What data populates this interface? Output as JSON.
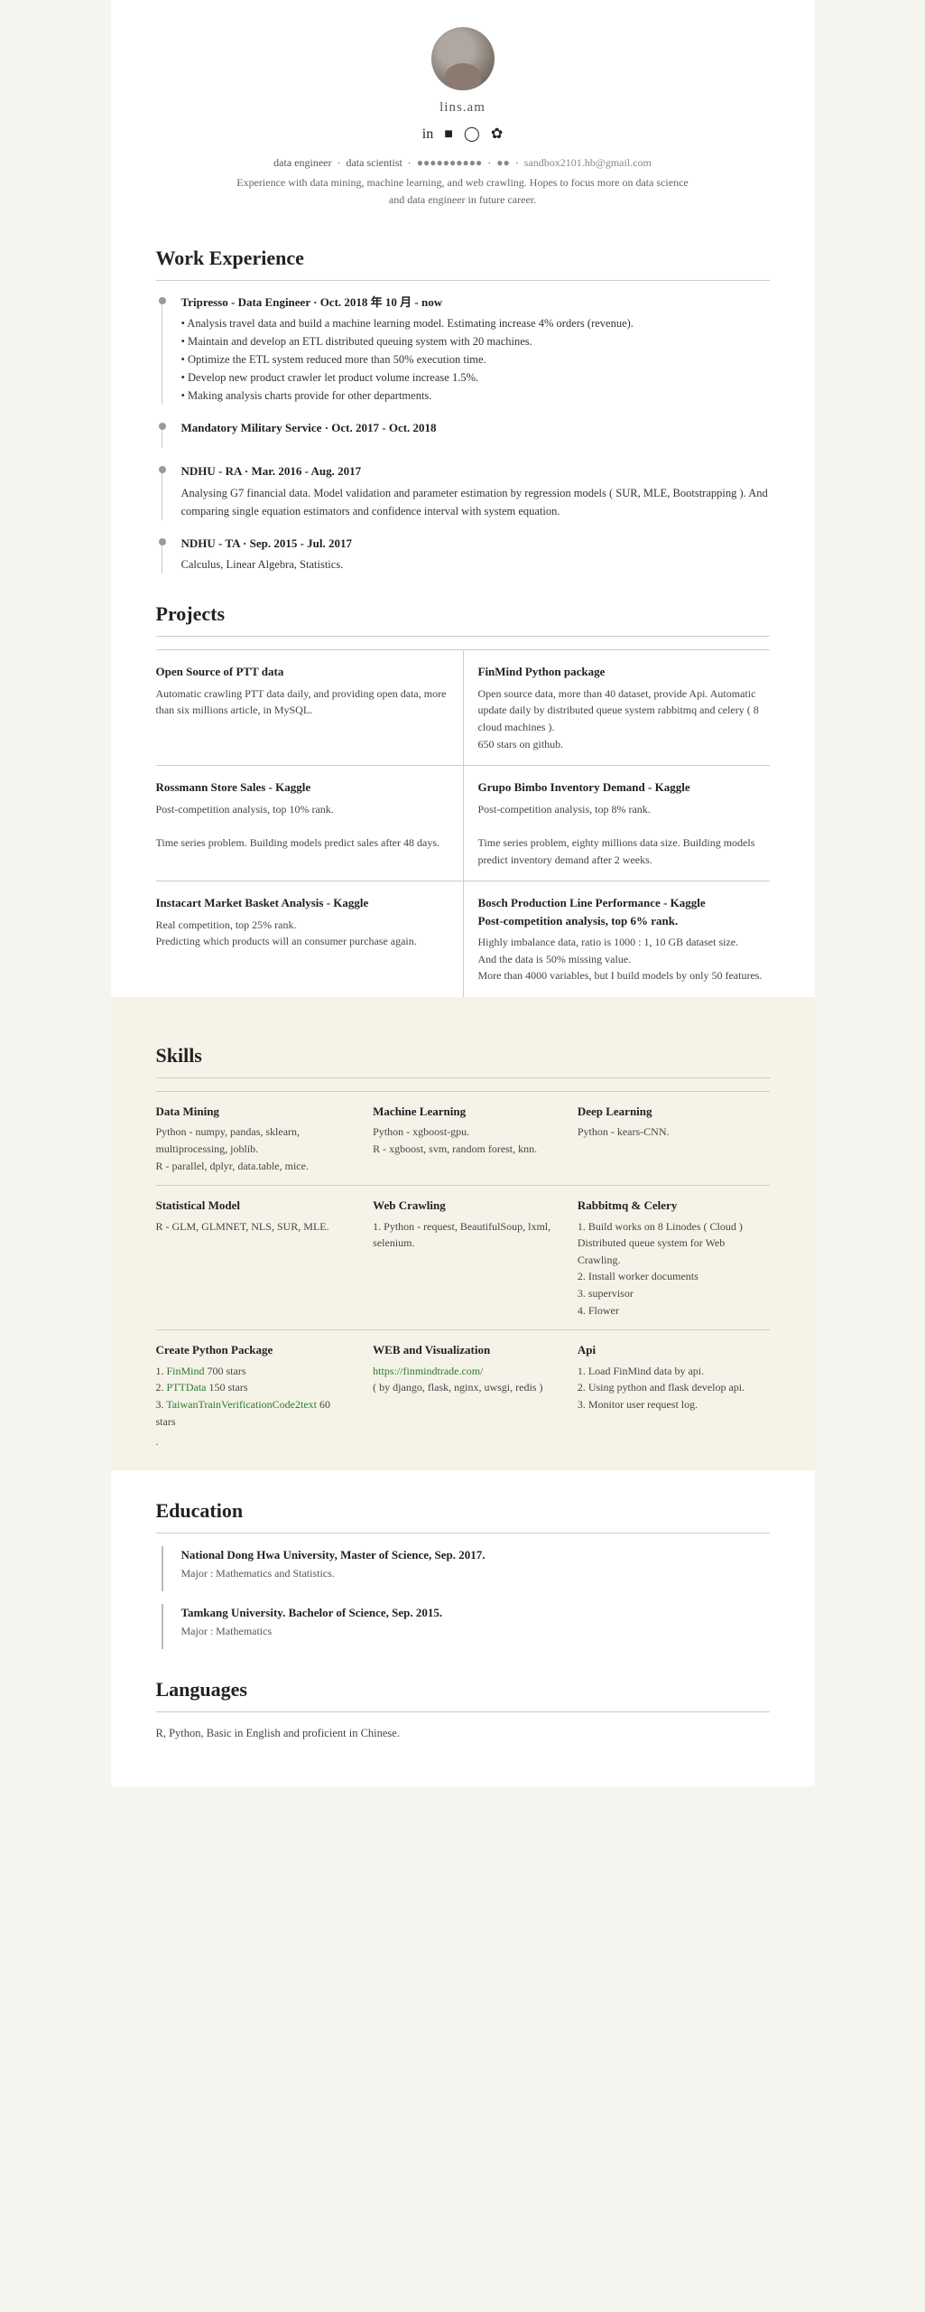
{
  "header": {
    "name": "lins.am",
    "tagline": "data engineer · data scientist · [phone] · [location] · sandbox2101.hb@gmail.com",
    "bio": "Experience with data mining, machine learning, and web crawling. Hopes to focus more on data science and data engineer in future career.",
    "social": [
      "in",
      "f",
      "⌥",
      "✿"
    ]
  },
  "sections": {
    "work_experience": "Work Experience",
    "projects": "Projects",
    "skills": "Skills",
    "education": "Education",
    "languages": "Languages"
  },
  "work": [
    {
      "title": "Tripresso - Data Engineer · Oct. 2018 年 10 月 - now",
      "desc": "• Analysis travel data and build a machine learning model. Estimating increase 4% orders (revenue).\n• Maintain and develop an ETL distributed queuing system with 20 machines.\n• Optimize the ETL system reduced more than 50% execution time.\n• Develop new product crawler let product volume increase 1.5%.\n• Making analysis charts provide for other departments."
    },
    {
      "title": "Mandatory Military Service · Oct. 2017 - Oct. 2018",
      "desc": ""
    },
    {
      "title": "NDHU - RA · Mar. 2016 - Aug. 2017",
      "desc": "Analysing G7 financial data. Model validation and parameter estimation by regression models ( SUR, MLE, Bootstrapping ). And comparing single equation estimators and confidence interval with system equation."
    },
    {
      "title": "NDHU - TA · Sep. 2015 - Jul. 2017",
      "desc": "Calculus, Linear Algebra, Statistics."
    }
  ],
  "projects": [
    {
      "title": "Open Source of PTT data",
      "desc": "Automatic crawling PTT data daily, and providing open data, more than six millions article, in MySQL."
    },
    {
      "title": "FinMind Python package",
      "desc": "Open source data, more than 40 dataset, provide Api. Automatic update daily by distributed queue system rabbitmq and celery ( 8 cloud machines ). 650 stars on github."
    },
    {
      "title": "Rossmann Store Sales - Kaggle",
      "desc": "Post-competition analysis, top 10% rank.\n\nTime series problem. Building models predict sales after 48 days."
    },
    {
      "title": "Grupo Bimbo Inventory Demand - Kaggle",
      "desc": "Post-competition analysis, top 8% rank.\n\nTime series problem, eighty millions data size. Building models predict inventory demand after 2 weeks."
    },
    {
      "title": "Instacart Market Basket Analysis - Kaggle",
      "desc": "Real competition, top 25% rank.\nPredicting which products will an consumer purchase again."
    },
    {
      "title": "Bosch Production Line Performance - Kaggle Post-competition analysis, top 6% rank.",
      "desc": "Highly imbalance data, ratio is 1000 : 1, 10 GB dataset size.\nAnd the data is 50% missing value.\nMore than 4000 variables, but I build models by only 50 features."
    }
  ],
  "skills": [
    {
      "title": "Data Mining",
      "desc": "Python - numpy, pandas, sklearn, multiprocessing, joblib.\nR - parallel, dplyr, data.table, mice."
    },
    {
      "title": "Machine Learning",
      "desc": "Python - xgboost-gpu.\nR - xgboost, svm, random forest, knn."
    },
    {
      "title": "Deep Learning",
      "desc": "Python - kears-CNN."
    },
    {
      "title": "Statistical Model",
      "desc": "R - GLM, GLMNET, NLS, SUR, MLE."
    },
    {
      "title": "Web Crawling",
      "desc": "1. Python - request, BeautifulSoup, lxml, selenium."
    },
    {
      "title": "Rabbitmq & Celery",
      "desc": "1. Build works on 8 Linodes ( Cloud )\nDistributed queue system for Web Crawling.\n2. Install worker documents\n3. supervisor\n4. Flower"
    },
    {
      "title": "Create Python Package",
      "desc": "1. FinMind 700 stars\n2. PTTData 150 stars\n3. TaiwanTrainVerificationCode2text 60 stars"
    },
    {
      "title": "WEB and Visualization",
      "desc_link": "https://finmindtrade.com/",
      "desc_suffix": "( by django, flask, nginx, uwsgi, redis )"
    },
    {
      "title": "Api",
      "desc": "1. Load FinMind data by api.\n2. Using python and flask develop api.\n3. Monitor user request log."
    }
  ],
  "education": [
    {
      "title": "National Dong Hwa University, Master of Science,  Sep. 2017.",
      "sub": "Major : Mathematics and Statistics."
    },
    {
      "title": "Tamkang University. Bachelor of Science, Sep. 2015.",
      "sub": "Major : Mathematics"
    }
  ],
  "languages": {
    "desc": "R, Python, Basic in English and proficient in Chinese."
  }
}
